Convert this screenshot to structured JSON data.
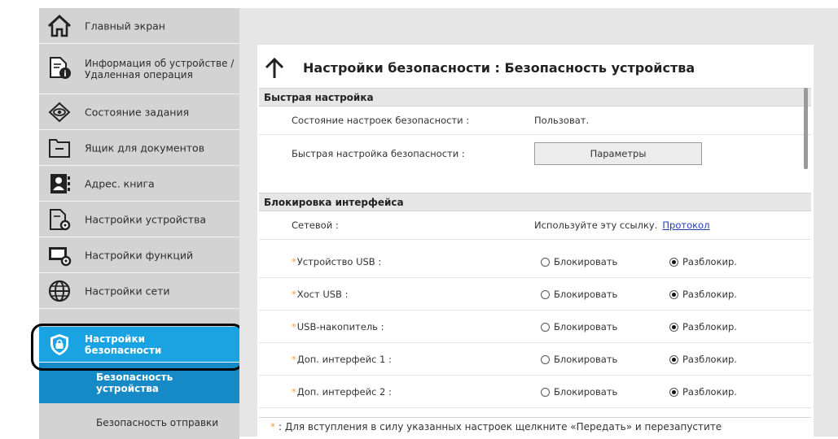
{
  "sidebar": {
    "items": [
      {
        "label": "Главный экран",
        "icon": "home-icon"
      },
      {
        "label": "Информация об устройстве / Удаленная операция",
        "icon": "device-info-icon"
      },
      {
        "label": "Состояние задания",
        "icon": "eye-icon"
      },
      {
        "label": "Ящик для документов",
        "icon": "document-box-icon"
      },
      {
        "label": "Адрес. книга",
        "icon": "address-book-icon"
      },
      {
        "label": "Настройки устройства",
        "icon": "device-settings-icon"
      },
      {
        "label": "Настройки функций",
        "icon": "function-settings-icon"
      },
      {
        "label": "Настройки сети",
        "icon": "globe-icon"
      },
      {
        "label": "Настройки безопасности",
        "icon": "shield-lock-icon"
      }
    ],
    "subitems": [
      {
        "label": "Безопасность устройства"
      },
      {
        "label": "Безопасность отправки"
      }
    ]
  },
  "page": {
    "title": "Настройки безопасности : Безопасность устройства"
  },
  "quick": {
    "header": "Быстрая настройка",
    "status_label": "Состояние настроек безопасности :",
    "status_value": "Пользоват.",
    "quick_label": "Быстрая настройка безопасности :",
    "params_button": "Параметры"
  },
  "lock": {
    "header": "Блокировка интерфейса",
    "network_label": "Сетевой :",
    "network_value": "Используйте эту ссылку.",
    "protocol_link": "Протокол",
    "lock_option": "Блокировать",
    "unlock_option": "Разблокир.",
    "rows": [
      {
        "label": "Устройство USB :"
      },
      {
        "label": "Хост USB :"
      },
      {
        "label": "USB-накопитель :"
      },
      {
        "label": "Доп. интерфейс 1 :"
      },
      {
        "label": "Доп. интерфейс 2 :"
      }
    ]
  },
  "footer": {
    "star": "*",
    "note": ": Для вступления в силу указанных настроек щелкните «Передать» и перезапустите"
  },
  "colors": {
    "accent": "#1aa3e2",
    "accent_dark": "#168ac6",
    "required_star": "#f2a33a",
    "link": "#1f3fb0"
  }
}
